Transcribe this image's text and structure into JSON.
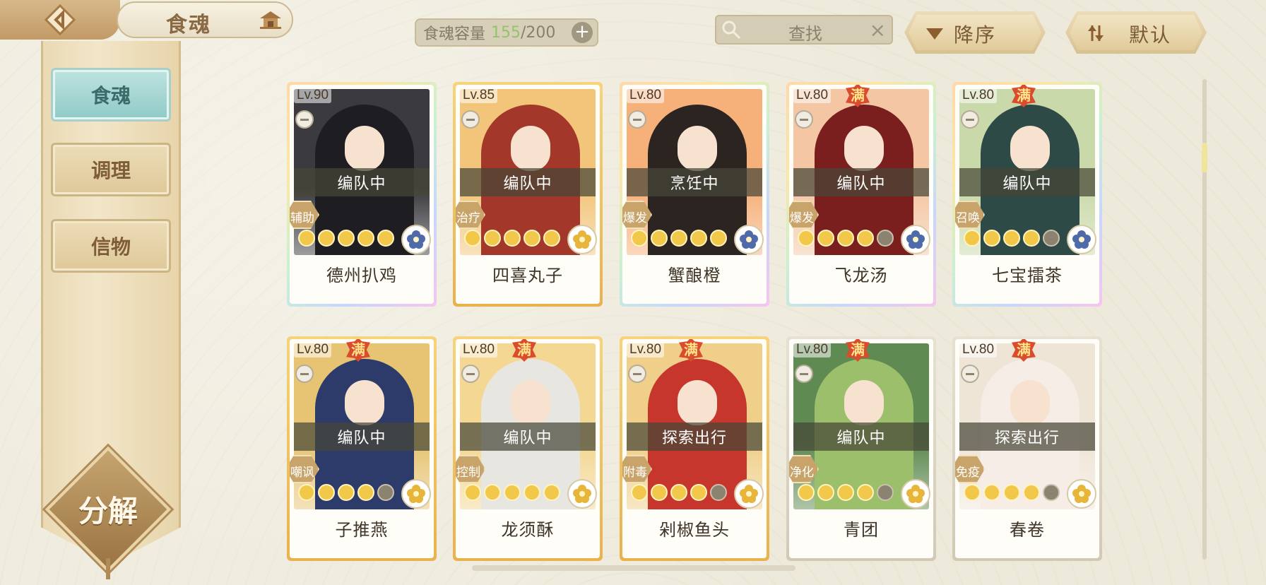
{
  "header": {
    "title": "食魂",
    "capacity_label": "食魂容量",
    "capacity_current": "155",
    "capacity_max": "/200",
    "capacity_add": "+",
    "search_placeholder": "查找",
    "search_clear": "×",
    "sort_order": "降序",
    "sort_mode": "默认"
  },
  "sidebar": {
    "items": [
      {
        "label": "食魂",
        "active": true
      },
      {
        "label": "调理",
        "active": false
      },
      {
        "label": "信物",
        "active": false
      }
    ],
    "decompose_label": "分解"
  },
  "cards": [
    {
      "level": "Lv.90",
      "full": false,
      "status": "编队中",
      "role": "辅助",
      "name": "德州扒鸡",
      "stars": 5,
      "frame": "rainbow",
      "bg": "#3b3b3f",
      "fig": "#1e1e22",
      "element": "blue"
    },
    {
      "level": "Lv.85",
      "full": false,
      "status": "编队中",
      "role": "治疗",
      "name": "四喜丸子",
      "stars": 5,
      "frame": "gold",
      "bg": "#f3c57a",
      "fig": "#a2372a",
      "element": "gold"
    },
    {
      "level": "Lv.80",
      "full": false,
      "status": "烹饪中",
      "role": "爆发",
      "name": "蟹酿橙",
      "stars": 5,
      "frame": "rainbow",
      "bg": "#f6b07a",
      "fig": "#2c2420",
      "element": "blue"
    },
    {
      "level": "Lv.80",
      "full": true,
      "full_label": "满",
      "status": "编队中",
      "role": "爆发",
      "name": "飞龙汤",
      "stars": 4,
      "frame": "rainbow",
      "bg": "#f4c6a3",
      "fig": "#7b1e1e",
      "element": "blue"
    },
    {
      "level": "Lv.80",
      "full": true,
      "full_label": "满",
      "status": "编队中",
      "role": "召唤",
      "name": "七宝擂茶",
      "stars": 4,
      "frame": "rainbow",
      "bg": "#c9d9a9",
      "fig": "#2e4a46",
      "element": "blue"
    },
    {
      "level": "Lv.80",
      "full": true,
      "full_label": "满",
      "status": "编队中",
      "role": "嘲讽",
      "name": "子推燕",
      "stars": 4,
      "frame": "gold",
      "bg": "#e6c474",
      "fig": "#2d3b6a",
      "element": "gold"
    },
    {
      "level": "Lv.80",
      "full": true,
      "full_label": "满",
      "status": "编队中",
      "role": "控制",
      "name": "龙须酥",
      "stars": 5,
      "frame": "gold",
      "bg": "#f3d793",
      "fig": "#e8e6e0",
      "element": "gold"
    },
    {
      "level": "Lv.80",
      "full": true,
      "full_label": "满",
      "status": "探索出行",
      "role": "附毒",
      "name": "剁椒鱼头",
      "stars": 4,
      "frame": "gold",
      "bg": "#f0cf8a",
      "fig": "#c7362d",
      "element": "gold"
    },
    {
      "level": "Lv.80",
      "full": true,
      "full_label": "满",
      "status": "编队中",
      "role": "净化",
      "name": "青团",
      "stars": 4,
      "frame": "plain",
      "bg": "#5f8a52",
      "fig": "#9bbf6a",
      "element": "gold"
    },
    {
      "level": "Lv.80",
      "full": true,
      "full_label": "满",
      "status": "探索出行",
      "role": "免疫",
      "name": "春卷",
      "stars": 4,
      "frame": "plain",
      "bg": "#efe5d7",
      "fig": "#f6eee6",
      "element": "gold"
    }
  ],
  "icons": {
    "back": "back-arrow-icon",
    "house": "house-icon",
    "search": "search-icon",
    "sort_desc": "sort-desc-icon",
    "sort_default": "sort-default-icon"
  }
}
